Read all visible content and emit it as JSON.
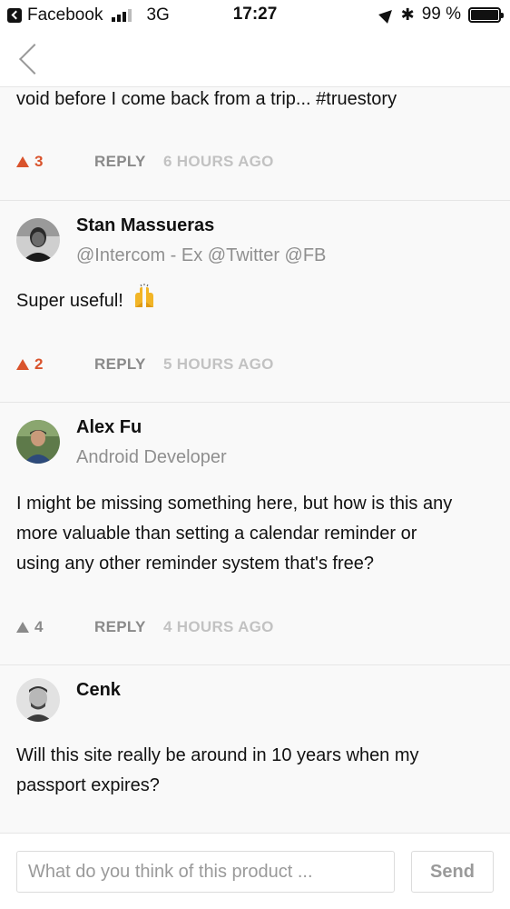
{
  "status_bar": {
    "back_app": "Facebook",
    "network": "3G",
    "time": "17:27",
    "battery": "99 %",
    "icons": [
      "back-app-icon",
      "signal-icon",
      "location-icon",
      "bluetooth-icon",
      "battery-icon"
    ]
  },
  "nav": {
    "back_icon": "chevron-left-icon"
  },
  "comments": [
    {
      "body_lines": [
        "void before I come back from a trip... #truestory"
      ],
      "upvotes": "3",
      "upvoted": true,
      "reply_label": "REPLY",
      "time_ago": "6 HOURS AGO"
    },
    {
      "author": "Stan Massueras",
      "headline": "@Intercom - Ex @Twitter @FB",
      "body_lines": [
        "Super useful!"
      ],
      "emoji": "raising-hands-emoji",
      "upvotes": "2",
      "upvoted": true,
      "reply_label": "REPLY",
      "time_ago": "5 HOURS AGO"
    },
    {
      "author": "Alex Fu",
      "headline": "Android Developer",
      "body_lines": [
        "I might be missing something here, but how is this any",
        "more valuable than setting a calendar reminder or",
        "using any other reminder system that's free?"
      ],
      "upvotes": "4",
      "upvoted": false,
      "reply_label": "REPLY",
      "time_ago": "4 HOURS AGO"
    },
    {
      "author": "Cenk",
      "headline": "",
      "body_lines": [
        "Will this site really be around in 10 years when my",
        "passport expires?"
      ]
    }
  ],
  "composer": {
    "placeholder": "What do you think of this product ...",
    "send_label": "Send"
  },
  "colors": {
    "upvote_active": "#d9532c",
    "upvote_inactive": "#8a8a8a",
    "muted_text": "#8f8f8f",
    "background": "#f9f9f9"
  }
}
